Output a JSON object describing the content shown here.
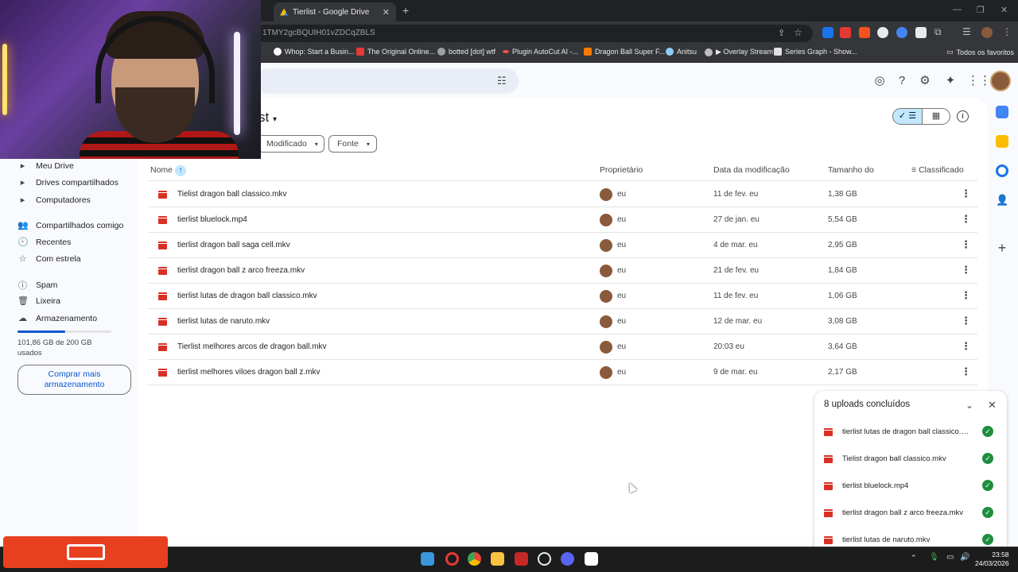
{
  "browser": {
    "tab_title": "Tierlist - Google Drive",
    "tab_close": "✕",
    "new_tab": "+",
    "window_controls": [
      "—",
      "❐",
      "✕"
    ],
    "address": "1TMY2gcBQUIH01vZDCqZBLS",
    "bookmarks": [
      {
        "label": "Whop: Start a Busin...",
        "color": "#ffffff"
      },
      {
        "label": "The Original Online...",
        "color": "#e53935"
      },
      {
        "label": "botted [dot] wtf",
        "color": "#9aa0a6"
      },
      {
        "label": "Plugin AutoCut AI -...",
        "color": "#ef5350"
      },
      {
        "label": "Dragon Ball Super F...",
        "color": "#f57c00"
      },
      {
        "label": "Anitsu",
        "color": "#90caf9"
      },
      {
        "label": "▶ Overlay Stream",
        "color": "#bdbdbd"
      },
      {
        "label": "Series Graph - Show...",
        "color": "#e0e0e0"
      }
    ],
    "favorites_folder": "Todos os favoritos"
  },
  "drive": {
    "page_title": "st",
    "filters": [
      {
        "label": "Modificado"
      },
      {
        "label": "Fonte"
      }
    ],
    "columns": {
      "name": "Nome",
      "owner": "Proprietário",
      "modified": "Data da modificação",
      "size": "Tamanho do",
      "sort": "Classificado"
    },
    "files": [
      {
        "name": "Tielist dragon ball classico.mkv",
        "owner": "eu",
        "modified": "11 de fev. eu",
        "size": "1,38 GB"
      },
      {
        "name": "tierlist bluelock.mp4",
        "owner": "eu",
        "modified": "27 de jan. eu",
        "size": "5,54 GB"
      },
      {
        "name": "tierlist dragon ball saga cell.mkv",
        "owner": "eu",
        "modified": "4 de mar. eu",
        "size": "2,95 GB"
      },
      {
        "name": "tierlist dragon ball z arco freeza.mkv",
        "owner": "eu",
        "modified": "21 de fev. eu",
        "size": "1,84 GB"
      },
      {
        "name": "tierlist lutas de dragon ball classico.mkv",
        "owner": "eu",
        "modified": "11 de fev. eu",
        "size": "1,06 GB"
      },
      {
        "name": "tierlist lutas de naruto.mkv",
        "owner": "eu",
        "modified": "12 de mar. eu",
        "size": "3,08 GB"
      },
      {
        "name": "Tierlist melhores arcos de dragon ball.mkv",
        "owner": "eu",
        "modified": "20:03 eu",
        "size": "3,64 GB"
      },
      {
        "name": "tierlist melhores viloes dragon ball z.mkv",
        "owner": "eu",
        "modified": "9 de mar. eu",
        "size": "2,17 GB"
      }
    ]
  },
  "sidebar": {
    "items": [
      {
        "label": "Meu Drive",
        "icon": "▸"
      },
      {
        "label": "Drives compartilhados",
        "icon": "▸"
      },
      {
        "label": "Computadores",
        "icon": "▸"
      },
      {
        "label": "Compartilhados comigo",
        "icon": "👥"
      },
      {
        "label": "Recentes",
        "icon": "🕘"
      },
      {
        "label": "Com estrela",
        "icon": "☆"
      },
      {
        "label": "Spam",
        "icon": "ⓘ"
      },
      {
        "label": "Lixeira",
        "icon": "🗑"
      },
      {
        "label": "Armazenamento",
        "icon": "☁"
      }
    ],
    "storage_text": "101,86 GB de 200 GB usados",
    "storage_fraction": 0.509,
    "buy_button": "Comprar mais armazenamento"
  },
  "uploads": {
    "title": "8 uploads concluídos",
    "items": [
      {
        "name": "tierlist lutas de dragon ball classico.mkv"
      },
      {
        "name": "Tielist dragon ball classico.mkv"
      },
      {
        "name": "tierlist bluelock.mp4"
      },
      {
        "name": "tierlist dragon ball z arco freeza.mkv"
      },
      {
        "name": "tierlist lutas de naruto.mkv"
      }
    ]
  },
  "taskbar": {
    "time": "23:58",
    "date": "24/03/2026"
  },
  "colors": {
    "accent": "#0b57d0",
    "video_icon": "#d93025",
    "success": "#1e8e3e",
    "stream_overlay": "#e8401f"
  }
}
